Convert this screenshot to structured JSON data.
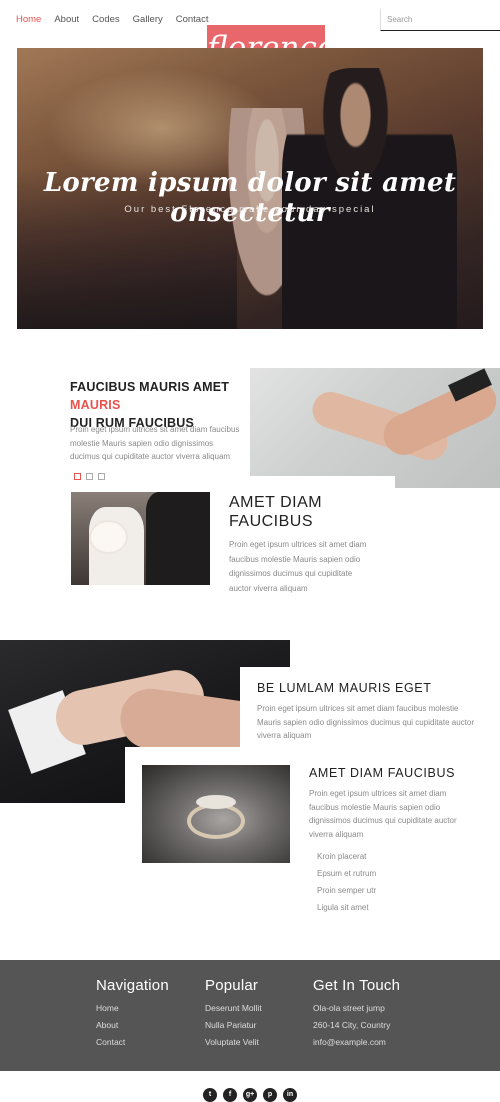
{
  "nav": {
    "items": [
      "Home",
      "About",
      "Codes",
      "Gallery",
      "Contact"
    ],
    "active_color": "#e8534f"
  },
  "search": {
    "placeholder": "Search"
  },
  "logo": {
    "text": "florence",
    "bg": "#e8676a"
  },
  "hero": {
    "title": "Lorem ipsum dolor sit amet onsectetur",
    "subtitle": "Our best Florence make your day special"
  },
  "feature1": {
    "heading_main": "FAUCIBUS MAURIS AMET",
    "heading_highlight": "MAURIS",
    "heading_line2": "DUI RUM FAUCIBUS",
    "text": "Proin eget ipsum ultrices sit amet diam faucibus molestie Mauris sapien odio dignissimos ducimus qui cupiditate auctor viverra aliquam"
  },
  "feature2": {
    "title": "AMET DIAM FAUCIBUS",
    "text": "Proin eget ipsum ultrices sit amet diam faucibus molestie Mauris sapien odio dignissimos ducimus qui cupiditate auctor viverra aliquam"
  },
  "feature3": {
    "title": "BE LUMLAM MAURIS EGET",
    "text": "Proin eget ipsum ultrices sit amet diam faucibus molestie Mauris sapien odio dignissimos ducimus qui cupiditate auctor viverra aliquam"
  },
  "feature4": {
    "title": "AMET DIAM FAUCIBUS",
    "text": "Proin eget ipsum ultrices sit amet diam faucibus molestie Mauris sapien odio dignissimos ducimus qui cupiditate auctor viverra aliquam",
    "list": [
      "Kroin placerat",
      "Epsum et rutrum",
      "Proin semper utr",
      "Ligula sit amet"
    ]
  },
  "footer": {
    "navigation": {
      "title": "Navigation",
      "items": [
        "Home",
        "About",
        "Contact"
      ]
    },
    "popular": {
      "title": "Popular",
      "items": [
        "Deserunt Mollit",
        "Nulla Pariatur",
        "Voluptate Velit"
      ]
    },
    "contact": {
      "title": "Get In Touch",
      "items": [
        "Ola-ola street jump",
        "260-14 City, Country",
        "info@example.com"
      ]
    },
    "bg": "#555555"
  },
  "social": {
    "icons": [
      "twitter-icon",
      "facebook-icon",
      "google-plus-icon",
      "pinterest-icon",
      "linkedin-icon"
    ],
    "glyphs": [
      "t",
      "f",
      "g+",
      "p",
      "in"
    ]
  }
}
